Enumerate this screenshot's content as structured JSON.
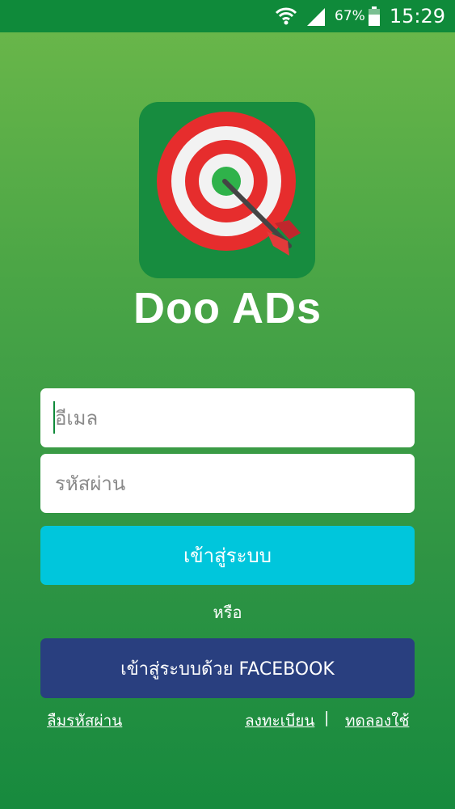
{
  "status_bar": {
    "battery_percent": "67%",
    "time": "15:29"
  },
  "app": {
    "name": "Doo ADs"
  },
  "login_form": {
    "email_placeholder": "อีเมล",
    "password_placeholder": "รหัสผ่าน",
    "login_button_label": "เข้าสู่ระบบ",
    "or_text": "หรือ",
    "facebook_button_label": "เข้าสู่ระบบด้วย FACEBOOK"
  },
  "links": {
    "forgot_password": "ลืมรหัสผ่าน",
    "register": "ลงทะเบียน",
    "separator": "|",
    "trial": "ทดลองใช้"
  },
  "colors": {
    "brand_green": "#178c3f",
    "login_button": "#00c6dc",
    "facebook_button": "#293f7f"
  }
}
